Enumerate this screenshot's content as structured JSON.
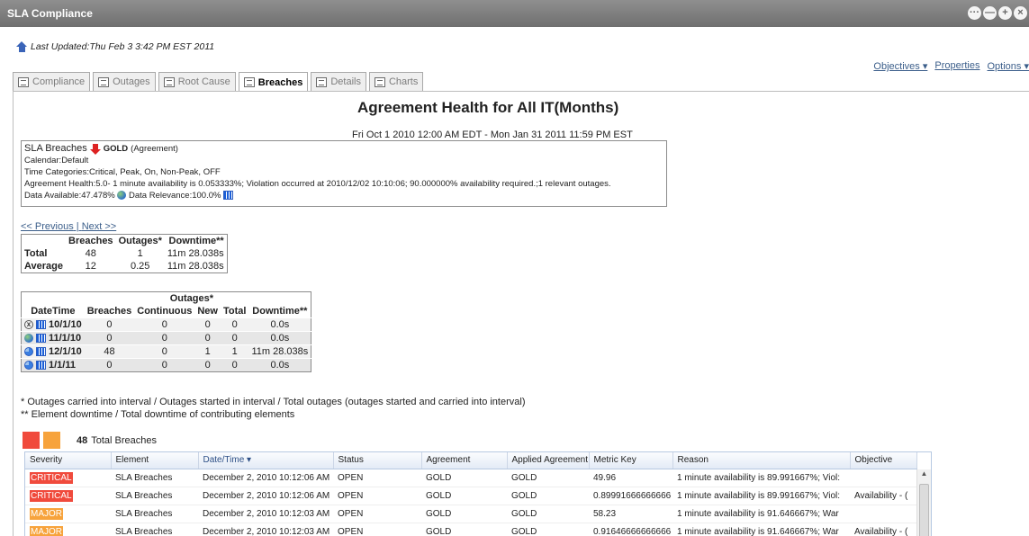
{
  "window": {
    "title": "SLA Compliance",
    "controls": [
      "···",
      "—",
      "+",
      "×"
    ]
  },
  "last_updated": "Last Updated:Thu Feb 3 3:42 PM EST 2011",
  "toplinks": [
    "Objectives ▾",
    "Properties",
    "Options ▾"
  ],
  "tabs": [
    {
      "label": "Compliance"
    },
    {
      "label": "Outages"
    },
    {
      "label": "Root Cause"
    },
    {
      "label": "Breaches"
    },
    {
      "label": "Details"
    },
    {
      "label": "Charts"
    }
  ],
  "report": {
    "title": "Agreement Health for All IT(Months)",
    "range": "Fri Oct 1 2010 12:00 AM EDT - Mon Jan 31 2011 11:59 PM EST"
  },
  "summary": {
    "heading": "SLA Breaches",
    "agreement": "GOLD",
    "agreement_suffix": "(Agreement)",
    "calendar": "Calendar:Default",
    "time_categories": "Time Categories:Critical, Peak, On, Non-Peak, OFF",
    "health": "Agreement Health:5.0- 1 minute availability is 0.053333%; Violation occurred at 2010/12/02 10:10:06; 90.000000% availability required.;1 relevant outages.",
    "data_available": "Data Available:47.478%",
    "data_relevance": "Data Relevance:100.0%"
  },
  "nav": {
    "previous": "<< Previous",
    "sep": " | ",
    "next": "Next >>"
  },
  "totals": {
    "headers": [
      "",
      "Breaches",
      "Outages*",
      "Downtime**"
    ],
    "rows": [
      [
        "Total",
        "48",
        "1",
        "11m 28.038s"
      ],
      [
        "Average",
        "12",
        "0.25",
        "11m 28.038s"
      ]
    ]
  },
  "periods": {
    "group_header": "Outages*",
    "headers": [
      "DateTime",
      "Breaches",
      "Continuous",
      "New",
      "Total",
      "Downtime**"
    ],
    "rows": [
      [
        "10/1/10",
        "0",
        "0",
        "0",
        "0",
        "0.0s"
      ],
      [
        "11/1/10",
        "0",
        "0",
        "0",
        "0",
        "0.0s"
      ],
      [
        "12/1/10",
        "48",
        "0",
        "1",
        "1",
        "11m 28.038s"
      ],
      [
        "1/1/11",
        "0",
        "0",
        "0",
        "0",
        "0.0s"
      ]
    ]
  },
  "footnotes": [
    "* Outages carried into interval / Outages started in interval / Total outages (outages started and carried into interval)",
    "** Element downtime / Total downtime of contributing elements"
  ],
  "legend": {
    "count": "48",
    "label": "Total Breaches",
    "colors": [
      "#f04a3c",
      "#f7a33c"
    ]
  },
  "breaches": {
    "headers": [
      "Severity",
      "Element",
      "Date/Time ▾",
      "Status",
      "Agreement",
      "Applied Agreement",
      "Metric Key",
      "Reason",
      "Objective"
    ],
    "rows": [
      [
        "CRITICAL",
        "SLA Breaches",
        "December 2, 2010 10:12:06 AM",
        "OPEN",
        "GOLD",
        "GOLD",
        "49.96",
        "1 minute availability is 89.991667%; Viol:",
        ""
      ],
      [
        "CRITICAL",
        "SLA Breaches",
        "December 2, 2010 10:12:06 AM",
        "OPEN",
        "GOLD",
        "GOLD",
        "0.89991666666666",
        "1 minute availability is 89.991667%; Viol:",
        "Availability - ("
      ],
      [
        "MAJOR",
        "SLA Breaches",
        "December 2, 2010 10:12:03 AM",
        "OPEN",
        "GOLD",
        "GOLD",
        "58.23",
        "1 minute availability is 91.646667%; War",
        ""
      ],
      [
        "MAJOR",
        "SLA Breaches",
        "December 2, 2010 10:12:03 AM",
        "OPEN",
        "GOLD",
        "GOLD",
        "0.91646666666666",
        "1 minute availability is 91.646667%; War",
        "Availability - ("
      ]
    ],
    "severity_colors": {
      "CRITICAL": "#f04a3c",
      "MAJOR": "#f7a33c"
    }
  }
}
